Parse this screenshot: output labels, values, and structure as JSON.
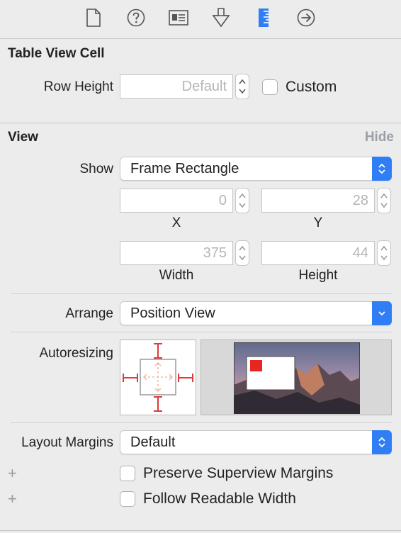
{
  "toolbar": {
    "icons": [
      "file-inspector-icon",
      "quick-help-icon",
      "identity-inspector-icon",
      "attributes-inspector-icon",
      "size-inspector-icon",
      "connections-inspector-icon"
    ]
  },
  "table_view_cell": {
    "title": "Table View Cell",
    "row_height_label": "Row Height",
    "row_height_placeholder": "Default",
    "custom_label": "Custom"
  },
  "view": {
    "title": "View",
    "hide_label": "Hide",
    "show_label": "Show",
    "show_value": "Frame Rectangle",
    "x_value": "0",
    "y_value": "28",
    "x_label": "X",
    "y_label": "Y",
    "width_value": "375",
    "height_value": "44",
    "width_label": "Width",
    "height_label": "Height",
    "arrange_label": "Arrange",
    "arrange_value": "Position View",
    "autoresizing_label": "Autoresizing",
    "layout_margins_label": "Layout Margins",
    "layout_margins_value": "Default",
    "preserve_label": "Preserve Superview Margins",
    "readable_label": "Follow Readable Width",
    "plus_symbol": "+"
  },
  "colors": {
    "accent": "#2f7ef5",
    "strut_red": "#e0393b",
    "selected_tab": "#2f7ef5"
  }
}
